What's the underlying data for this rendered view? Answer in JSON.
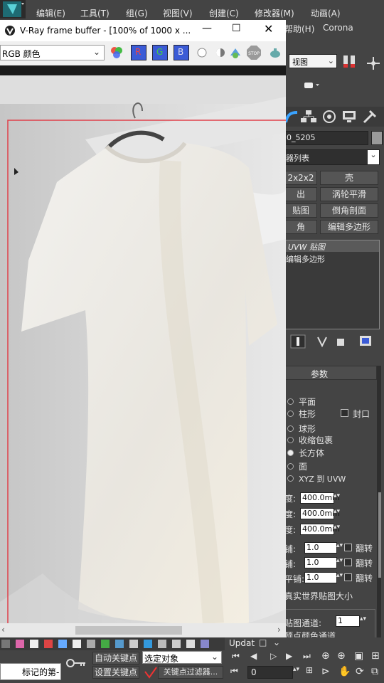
{
  "menu": {
    "items": [
      "编辑(E)",
      "工具(T)",
      "组(G)",
      "视图(V)",
      "创建(C)",
      "修改器(M)",
      "动画(A)"
    ],
    "help": "帮助(H)",
    "corona": "Corona"
  },
  "vfb": {
    "title": "V-Ray frame buffer - [100% of 1000 x ...",
    "channel": "RGB 颜色",
    "rgb_buttons": [
      "R",
      "G",
      "B"
    ],
    "stop_label": "STOP"
  },
  "toolbar": {
    "view_select": "视图"
  },
  "panel": {
    "object_name": "0_5205",
    "modifier_list": "器列表",
    "buttons": [
      "2x2x2",
      "壳",
      "出",
      "涡轮平滑",
      "贴图",
      "倒角剖面",
      "角",
      "编辑多边形"
    ],
    "stack": [
      "UVW 贴图",
      "编辑多边形"
    ],
    "rollout_title": "参数",
    "mapping": [
      {
        "label": "平面",
        "on": false
      },
      {
        "label": "柱形",
        "on": false
      },
      {
        "label": "球形",
        "on": false
      },
      {
        "label": "收缩包裹",
        "on": false
      },
      {
        "label": "长方体",
        "on": true
      },
      {
        "label": "面",
        "on": false
      },
      {
        "label": "XYZ 到 UVW",
        "on": false
      }
    ],
    "cap_label": "封口",
    "dims": [
      {
        "label": "度:",
        "value": "400.0mm"
      },
      {
        "label": "度:",
        "value": "400.0mm"
      },
      {
        "label": "度:",
        "value": "400.0mm"
      }
    ],
    "tiles": [
      {
        "label": "铺:",
        "value": "1.0",
        "flip": "翻转"
      },
      {
        "label": "铺:",
        "value": "1.0",
        "flip": "翻转"
      },
      {
        "label": "平铺:",
        "value": "1.0",
        "flip": "翻转"
      }
    ],
    "real_world": "真实世界贴图大小",
    "map_channel_label": "贴图通道:",
    "map_channel_value": "1",
    "vertex_color": "顶点颜色通道"
  },
  "bottom": {
    "update": "Updat",
    "auto_key": "自动关键点",
    "selected": "选定对象",
    "set_key": "设置关键点",
    "key_filter": "关键点过滤器...",
    "marker": "标记的第-",
    "frame": "0"
  },
  "colors": {
    "max_bg": "#444444",
    "red_border": "#e0404a",
    "vfb_bg": "#f0f0f0",
    "r_btn": "#3b5bd6"
  }
}
